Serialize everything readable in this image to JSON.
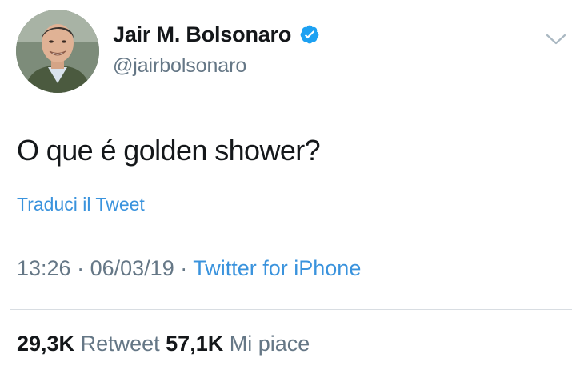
{
  "author": {
    "display_name": "Jair M. Bolsonaro",
    "handle": "@jairbolsonaro",
    "verified_icon": "verified-badge-icon",
    "avatar": "profile-photo"
  },
  "tweet": {
    "text": "O que é golden shower?",
    "translate_label": "Traduci il Tweet"
  },
  "meta": {
    "time": "13:26",
    "separator": "·",
    "date": "06/03/19",
    "source": "Twitter for iPhone"
  },
  "stats": {
    "retweets_count": "29,3K",
    "retweets_label": "Retweet",
    "likes_count": "57,1K",
    "likes_label": "Mi piace"
  },
  "colors": {
    "link": "#3a93dd",
    "secondary_text": "#657786",
    "primary_text": "#14171a",
    "verified": "#1da1f2"
  },
  "icons": {
    "more_menu": "chevron-down-icon"
  }
}
